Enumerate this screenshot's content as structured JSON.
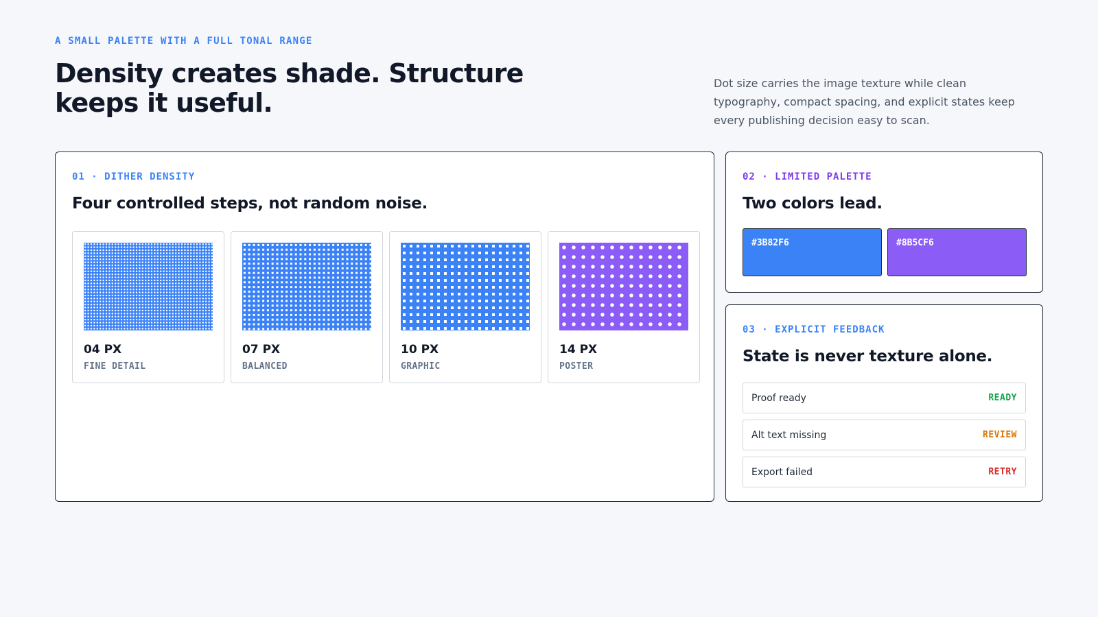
{
  "header": {
    "eyebrow": "A SMALL PALETTE WITH A FULL TONAL RANGE",
    "headline": "Density creates shade. Structure keeps it useful.",
    "intro": "Dot size carries the image texture while clean typography, compact spacing, and explicit states keep every publishing decision easy to scan."
  },
  "density": {
    "eyebrow": "01 · DITHER DENSITY",
    "title": "Four controlled steps, not random noise.",
    "tiles": [
      {
        "size": "04 PX",
        "label": "FINE DETAIL",
        "color": "#3B82F6"
      },
      {
        "size": "07 PX",
        "label": "BALANCED",
        "color": "#3B82F6"
      },
      {
        "size": "10 PX",
        "label": "GRAPHIC",
        "color": "#3B82F6"
      },
      {
        "size": "14 PX",
        "label": "POSTER",
        "color": "#8B5CF6"
      }
    ]
  },
  "palette": {
    "eyebrow": "02 · LIMITED PALETTE",
    "title": "Two colors lead.",
    "colors": [
      {
        "hex": "#3B82F6"
      },
      {
        "hex": "#8B5CF6"
      }
    ]
  },
  "feedback": {
    "eyebrow": "03 · EXPLICIT FEEDBACK",
    "title": "State is never texture alone.",
    "states": [
      {
        "label": "Proof ready",
        "badge": "READY",
        "color": "#16A34A"
      },
      {
        "label": "Alt text missing",
        "badge": "REVIEW",
        "color": "#D97706"
      },
      {
        "label": "Export failed",
        "badge": "RETRY",
        "color": "#DC2626"
      }
    ]
  },
  "theme": {
    "accent_blue": "#3B82F6",
    "accent_purple": "#8B5CF6",
    "eyebrow_blue": "#3B82F6",
    "eyebrow_purple": "#7C3AED"
  }
}
